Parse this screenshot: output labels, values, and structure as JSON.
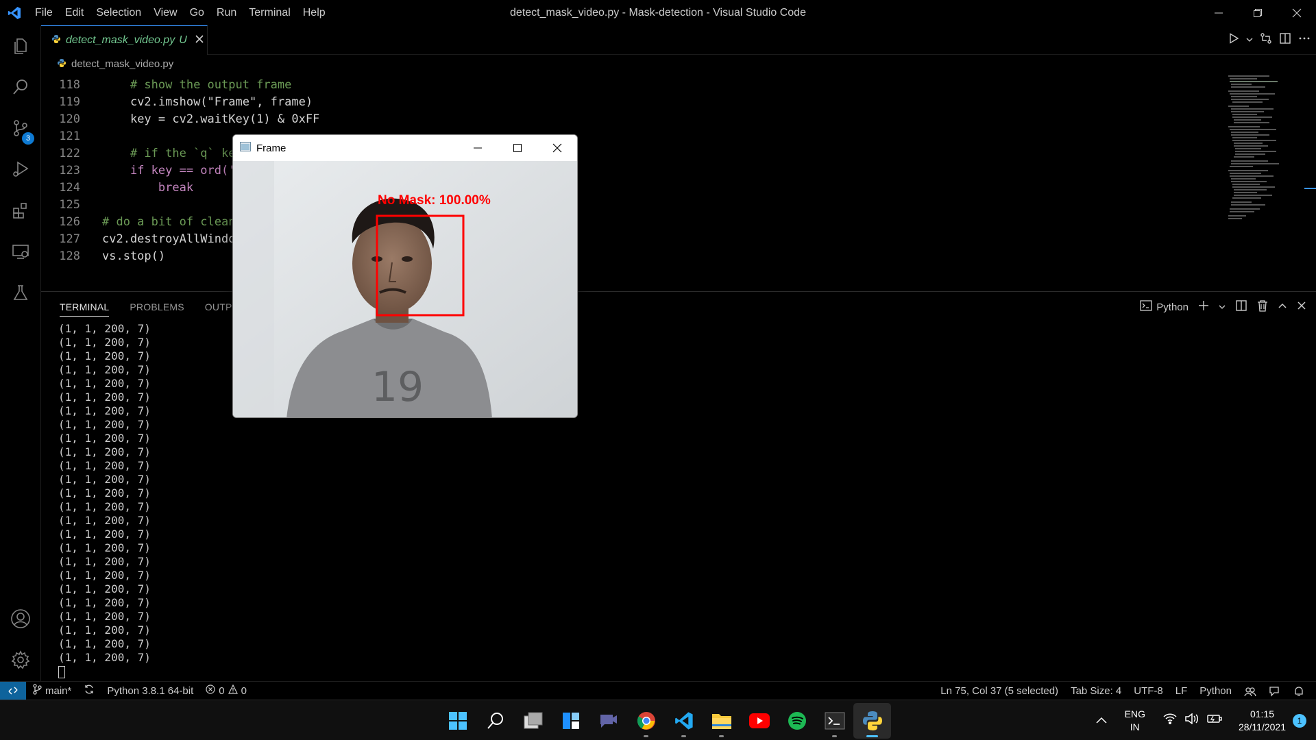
{
  "window": {
    "title": "detect_mask_video.py - Mask-detection - Visual Studio Code"
  },
  "menu": [
    "File",
    "Edit",
    "Selection",
    "View",
    "Go",
    "Run",
    "Terminal",
    "Help"
  ],
  "activity_bar": {
    "items": [
      "explorer-icon",
      "search-icon",
      "source-control-icon",
      "run-debug-icon",
      "extensions-icon",
      "remote-explorer-icon",
      "testing-icon"
    ],
    "source_control_badge": "3",
    "bottom": [
      "account-icon",
      "settings-gear-icon"
    ]
  },
  "tab": {
    "filename": "detect_mask_video.py",
    "status": "U"
  },
  "breadcrumb": {
    "file": "detect_mask_video.py"
  },
  "code": {
    "lines": [
      {
        "n": "118",
        "indent": "    ",
        "text": "# show the output frame"
      },
      {
        "n": "119",
        "indent": "    ",
        "text": "cv2.imshow(\"Frame\", frame)"
      },
      {
        "n": "120",
        "indent": "    ",
        "text": "key = cv2.waitKey(1) & 0xFF"
      },
      {
        "n": "121",
        "indent": "",
        "text": ""
      },
      {
        "n": "122",
        "indent": "    ",
        "text": "# if the `q` ke"
      },
      {
        "n": "123",
        "indent": "    ",
        "text": "if key == ord('"
      },
      {
        "n": "124",
        "indent": "        ",
        "text": "break"
      },
      {
        "n": "125",
        "indent": "",
        "text": ""
      },
      {
        "n": "126",
        "indent": "",
        "text": "# do a bit of clean"
      },
      {
        "n": "127",
        "indent": "",
        "text": "cv2.destroyAllWindo"
      },
      {
        "n": "128",
        "indent": "",
        "text": "vs.stop()"
      }
    ]
  },
  "panel": {
    "tabs": [
      "TERMINAL",
      "PROBLEMS",
      "OUTPUT"
    ],
    "active_tab": "TERMINAL",
    "shell_label": "Python",
    "terminal_output": [
      "(1, 1, 200, 7)",
      "(1, 1, 200, 7)",
      "(1, 1, 200, 7)",
      "(1, 1, 200, 7)",
      "(1, 1, 200, 7)",
      "(1, 1, 200, 7)",
      "(1, 1, 200, 7)",
      "(1, 1, 200, 7)",
      "(1, 1, 200, 7)",
      "(1, 1, 200, 7)",
      "(1, 1, 200, 7)",
      "(1, 1, 200, 7)",
      "(1, 1, 200, 7)",
      "(1, 1, 200, 7)",
      "(1, 1, 200, 7)",
      "(1, 1, 200, 7)",
      "(1, 1, 200, 7)",
      "(1, 1, 200, 7)",
      "(1, 1, 200, 7)",
      "(1, 1, 200, 7)",
      "(1, 1, 200, 7)",
      "(1, 1, 200, 7)",
      "(1, 1, 200, 7)",
      "(1, 1, 200, 7)",
      "(1, 1, 200, 7)"
    ]
  },
  "statusbar": {
    "branch": "main*",
    "interpreter": "Python 3.8.1 64-bit",
    "errors": "0",
    "warnings": "0",
    "cursor": "Ln 75, Col 37 (5 selected)",
    "tab_size": "Tab Size: 4",
    "encoding": "UTF-8",
    "eol": "LF",
    "language": "Python"
  },
  "frame_window": {
    "title": "Frame",
    "detection_label": "No Mask: 100.00%",
    "box_color": "#ff0000"
  },
  "taskbar": {
    "apps": [
      "start-icon",
      "search-icon",
      "task-view-icon",
      "widgets-icon",
      "chat-icon",
      "chrome-icon",
      "vscode-icon",
      "file-explorer-icon",
      "youtube-icon",
      "spotify-icon",
      "terminal-icon",
      "python-icon"
    ],
    "language_top": "ENG",
    "language_bottom": "IN",
    "time": "01:15",
    "date": "28/11/2021",
    "notification_count": "1"
  },
  "colors": {
    "accent": "#3794ff",
    "untracked": "#73c991",
    "badge": "#0e7ad3"
  }
}
